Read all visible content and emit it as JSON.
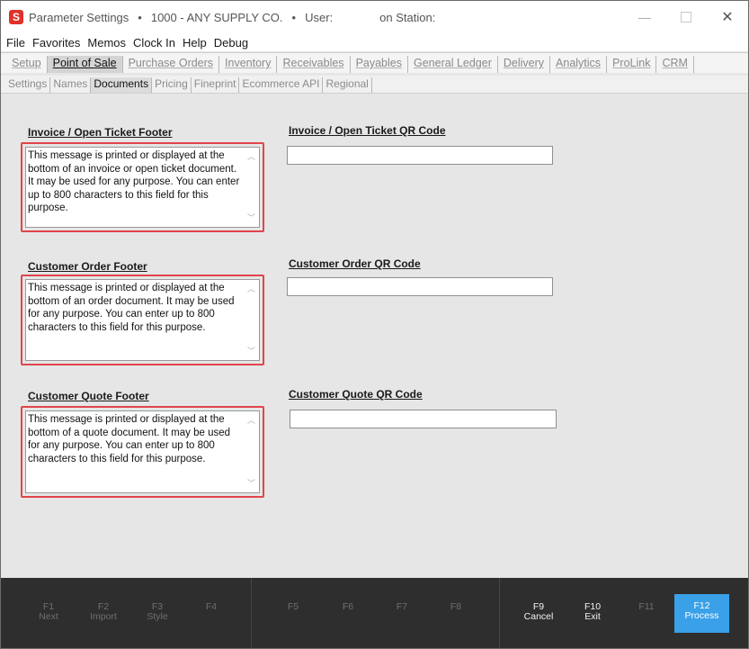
{
  "window": {
    "app_icon_letter": "S",
    "title": "Parameter Settings",
    "sep1": "•",
    "company": "1000 - ANY SUPPLY CO.",
    "sep2": "•",
    "user_label": "User:",
    "station_label": "on Station:",
    "minimize_glyph": "—",
    "close_glyph": "✕"
  },
  "menu": [
    "File",
    "Favorites",
    "Memos",
    "Clock In",
    "Help",
    "Debug"
  ],
  "tabs_main": [
    "Setup",
    "Point of Sale",
    "Purchase Orders",
    "Inventory",
    "Receivables",
    "Payables",
    "General Ledger",
    "Delivery",
    "Analytics",
    "ProLink",
    "CRM"
  ],
  "tabs_main_active": "Point of Sale",
  "tabs_sub": [
    "Settings",
    "Names",
    "Documents",
    "Pricing",
    "Fineprint",
    "Ecommerce API",
    "Regional"
  ],
  "tabs_sub_active": "Documents",
  "sections": {
    "invoice_footer": {
      "label": "Invoice / Open Ticket Footer",
      "text": "This message is printed or displayed at the bottom of an invoice or open ticket document.  It may be used for any purpose.  You can enter up to 800 characters to this field for this purpose."
    },
    "invoice_qr": {
      "label": "Invoice / Open Ticket QR Code",
      "value": ""
    },
    "order_footer": {
      "label": "Customer Order Footer",
      "text": "This message is printed or displayed at the bottom of an order document.  It may be used for any purpose.   You can enter up to 800 characters to this field for this purpose."
    },
    "order_qr": {
      "label": "Customer Order QR Code",
      "value": ""
    },
    "quote_footer": {
      "label": "Customer Quote Footer",
      "text": "This message is printed or displayed at the bottom of a quote document.  It may be used for any purpose. You can enter up to 800 characters to this field for this purpose."
    },
    "quote_qr": {
      "label": "Customer Quote QR Code",
      "value": ""
    }
  },
  "function_keys": [
    {
      "key": "F1",
      "label": "Next"
    },
    {
      "key": "F2",
      "label": "Import"
    },
    {
      "key": "F3",
      "label": "Style"
    },
    {
      "key": "F4",
      "label": ""
    },
    {
      "key": "F5",
      "label": ""
    },
    {
      "key": "F6",
      "label": ""
    },
    {
      "key": "F7",
      "label": ""
    },
    {
      "key": "F8",
      "label": ""
    },
    {
      "key": "F9",
      "label": "Cancel"
    },
    {
      "key": "F10",
      "label": "Exit"
    },
    {
      "key": "F11",
      "label": ""
    },
    {
      "key": "F12",
      "label": "Process"
    }
  ],
  "colors": {
    "highlight_border": "#e0454b",
    "process_button": "#3aa0e8",
    "footer_bg": "#2e2e2e",
    "app_icon": "#e0312b"
  }
}
